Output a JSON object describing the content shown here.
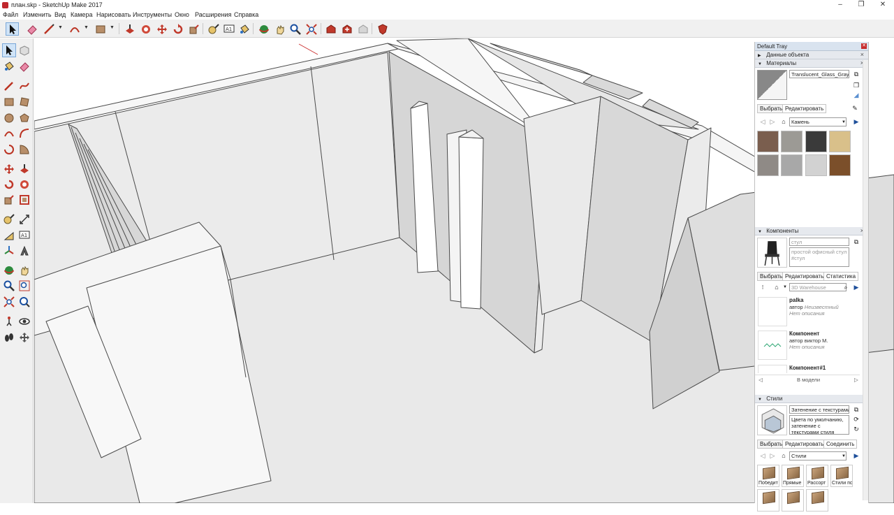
{
  "window": {
    "title": "план.skp - SketchUp Make 2017",
    "minimize": "–",
    "maximize": "❐",
    "close": "✕"
  },
  "menu": [
    "Файл",
    "Изменить",
    "Вид",
    "Камера",
    "Нарисовать",
    "Инструменты",
    "Окно",
    "Расширения",
    "Справка"
  ],
  "tray": {
    "title": "Default Tray",
    "entity_info": {
      "label": "Данные объекта"
    },
    "materials": {
      "label": "Материалы",
      "current_material": "Translucent_Glass_Gray",
      "tabs": [
        "Выбрать",
        "Редактировать"
      ],
      "library": "Камень",
      "swatch_colors": [
        "#7a5e4e",
        "#9c9a95",
        "#3a3a3a",
        "#d9c08a",
        "#8f8a86",
        "#a8a8a8",
        "#d2d2d2",
        "#7b4f2a"
      ]
    },
    "components": {
      "label": "Компоненты",
      "name_placeholder": "стул",
      "description": "простой офисный стул #стул",
      "tabs": [
        "Выбрать",
        "Редактировать",
        "Статистика"
      ],
      "search_placeholder": "3D Warehouse",
      "items": [
        {
          "name": "palka",
          "author_prefix": "автор",
          "author": "Неизвестный",
          "desc": "Нет описания"
        },
        {
          "name": "Компонент",
          "author_prefix": "автор",
          "author": "виктор М.",
          "desc": "Нет описания"
        },
        {
          "name": "Компонент#1"
        }
      ],
      "footer": "В модели"
    },
    "styles": {
      "label": "Стили",
      "style_name": "Затенение с текстурами",
      "style_desc": "Цвета по умолчанию, затенение с текстурами стиля",
      "tabs": [
        "Выбрать",
        "Редактировать",
        "Соединить"
      ],
      "library": "Стили",
      "tiles": [
        "Победит",
        "Прямые",
        "Рассорт",
        "Стили пс"
      ]
    }
  }
}
